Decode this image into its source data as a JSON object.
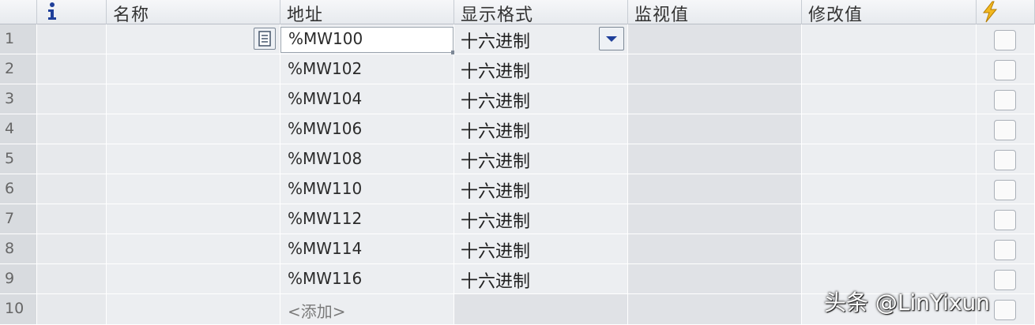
{
  "header": {
    "info_icon": "info-icon",
    "name": "名称",
    "address": "地址",
    "display_format": "显示格式",
    "monitor_value": "监视值",
    "modify_value": "修改值",
    "force_icon": "lightning-icon"
  },
  "rows": [
    {
      "num": "1",
      "address": "%MW100",
      "format": "十六进制"
    },
    {
      "num": "2",
      "address": "%MW102",
      "format": "十六进制"
    },
    {
      "num": "3",
      "address": "%MW104",
      "format": "十六进制"
    },
    {
      "num": "4",
      "address": "%MW106",
      "format": "十六进制"
    },
    {
      "num": "5",
      "address": "%MW108",
      "format": "十六进制"
    },
    {
      "num": "6",
      "address": "%MW110",
      "format": "十六进制"
    },
    {
      "num": "7",
      "address": "%MW112",
      "format": "十六进制"
    },
    {
      "num": "8",
      "address": "%MW114",
      "format": "十六进制"
    },
    {
      "num": "9",
      "address": "%MW116",
      "format": "十六进制"
    }
  ],
  "add_row": {
    "num": "10",
    "placeholder": "<添加>"
  },
  "watermark": "头条 @LinYixun",
  "colors": {
    "accent": "#1f3f9a",
    "lightning": "#f2b820"
  }
}
